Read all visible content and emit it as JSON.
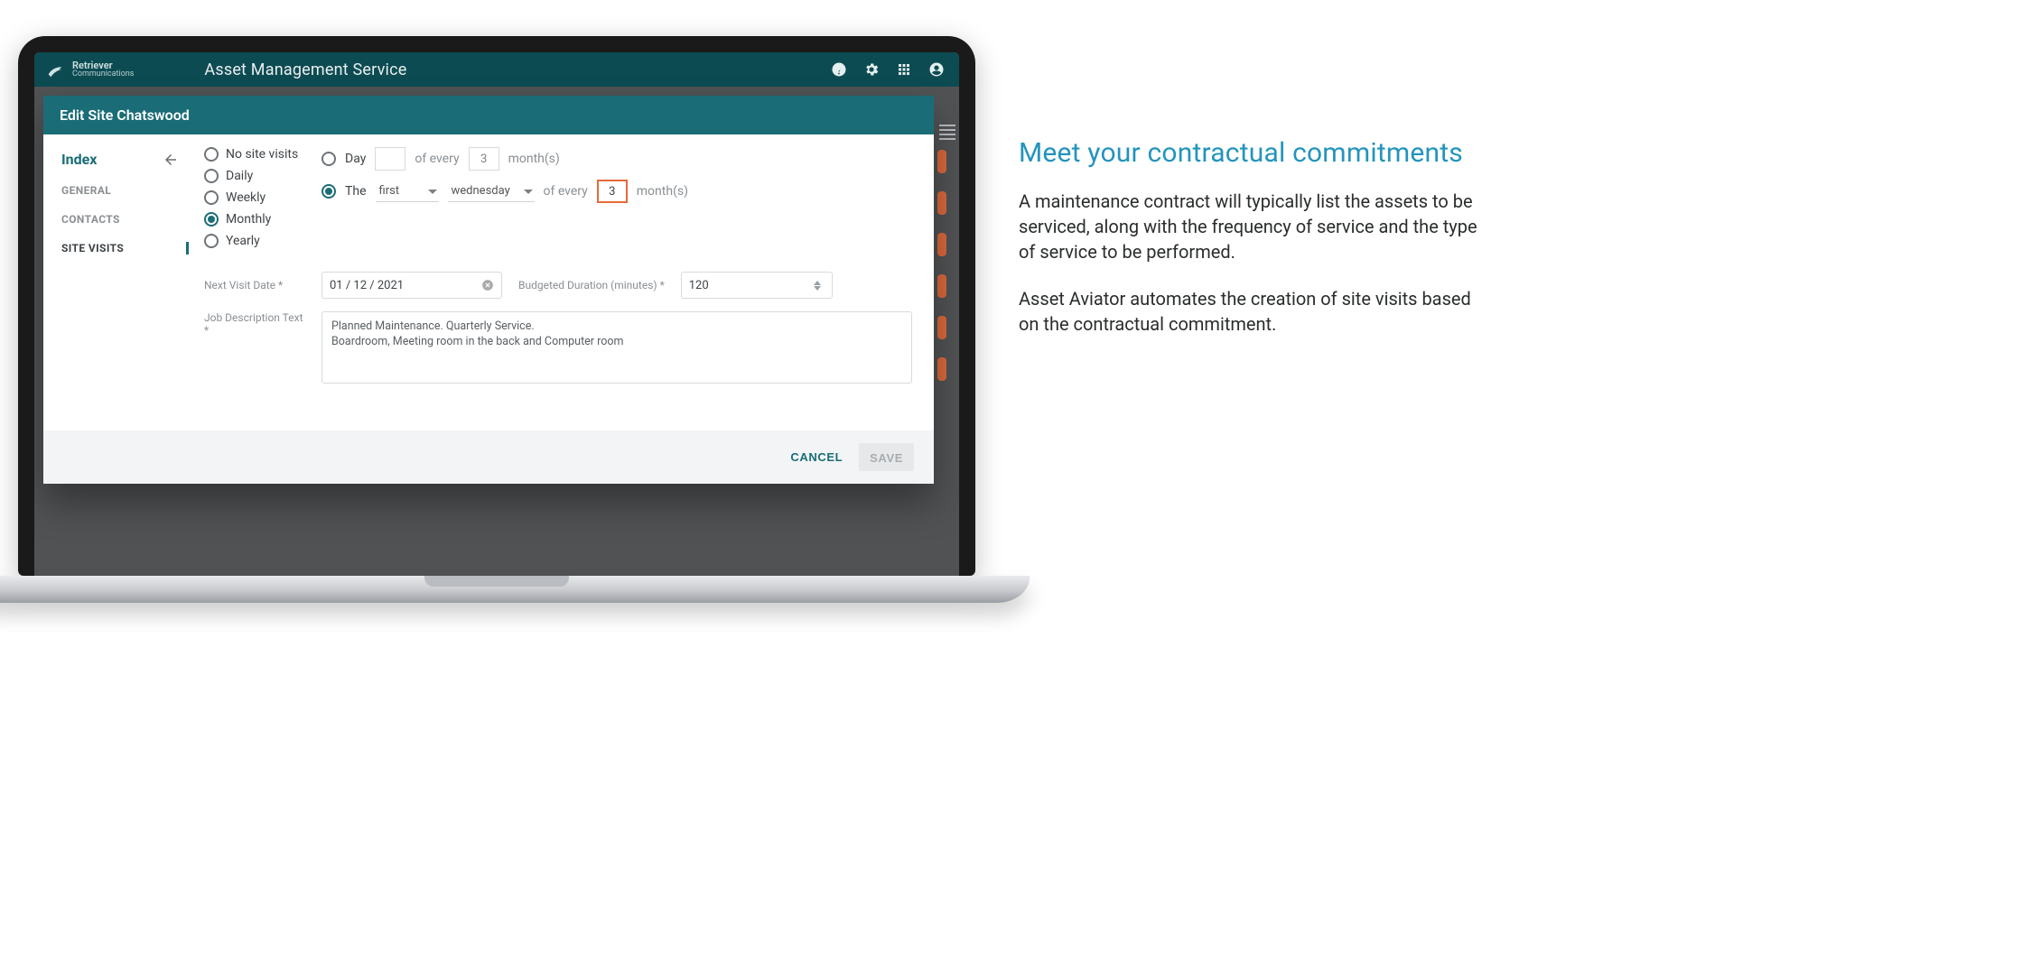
{
  "brand": {
    "line1": "Retriever",
    "line2": "Communications"
  },
  "app_title": "Asset Management Service",
  "modal": {
    "title": "Edit Site Chatswood",
    "index_label": "Index",
    "nav": {
      "general": "GENERAL",
      "contacts": "CONTACTS",
      "site_visits": "SITE VISITS"
    },
    "frequency": {
      "no_visits": "No site visits",
      "daily": "Daily",
      "weekly": "Weekly",
      "monthly": "Monthly",
      "yearly": "Yearly"
    },
    "pattern_day": {
      "label_day": "Day",
      "of_every": "of every",
      "months_count": "3",
      "months_suffix": "month(s)"
    },
    "pattern_the": {
      "label_the": "The",
      "ordinal": "first",
      "weekday": "wednesday",
      "of_every": "of every",
      "months_count": "3",
      "months_suffix": "month(s)"
    },
    "next_visit": {
      "label": "Next Visit Date *",
      "value": "01 / 12 / 2021"
    },
    "duration": {
      "label": "Budgeted Duration (minutes) *",
      "value": "120"
    },
    "job_desc": {
      "label": "Job Description Text *",
      "value": "Planned Maintenance. Quarterly Service.\nBoardroom, Meeting room in the back and Computer room"
    },
    "actions": {
      "cancel": "CANCEL",
      "save": "SAVE"
    }
  },
  "copy": {
    "heading": "Meet your contractual commitments",
    "p1": "A maintenance contract will typically list the assets to be serviced, along with the frequency of service and the type of service to be performed.",
    "p2": "Asset Aviator automates the creation of site visits based on the contractual commitment."
  }
}
